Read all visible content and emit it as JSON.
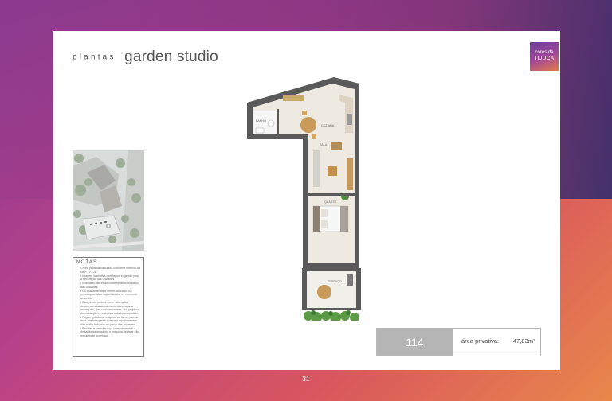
{
  "header": {
    "title_prefix": "plantas",
    "title_main": "garden studio"
  },
  "logo": {
    "line1": "cores da",
    "line2": "TIJUCA"
  },
  "plan": {
    "unit_large_digit": "1",
    "rooms": {
      "bathroom": "BANHO",
      "kitchen": "COZINHA",
      "living": "SALA",
      "bedroom": "QUARTO",
      "terrace": "TERRAÇO"
    }
  },
  "notes": {
    "heading": "NOTAS",
    "items": [
      "Área privativa calculada conforme critérios da NBR 12.721.",
      "Imagem ilustrativa com layout sugerido para a decoração das unidades.",
      "Mobiliário não estão contemplados no preço das unidades.",
      "Os acabamentos a serem utilizados na construção estão especificados no memorial descritivo.",
      "Esta planta poderá sofrer alterações decorrentes do atendimento das posturas municipais, das concessionárias, dos projetos de instalações e estrutura e da Incorporadora.",
      "Fogão, geladeira, máquina de lavar, piscina, deck, churrasqueira e demais equipamentos não estão incluídos no preço das unidades.",
      "Pavotes e paredes cujo único objetivo é a limitação da geladeira e máquina de lavar são meramente sugeridos."
    ]
  },
  "unit": {
    "number": "114",
    "area_label": "área privativa:",
    "area_value": "47,83m²"
  },
  "footer": {
    "page_number": "31"
  },
  "colors": {
    "unit_number_bg": "#b5b5b5",
    "wall": "#5a5a5a",
    "floor": "#efeae1"
  }
}
